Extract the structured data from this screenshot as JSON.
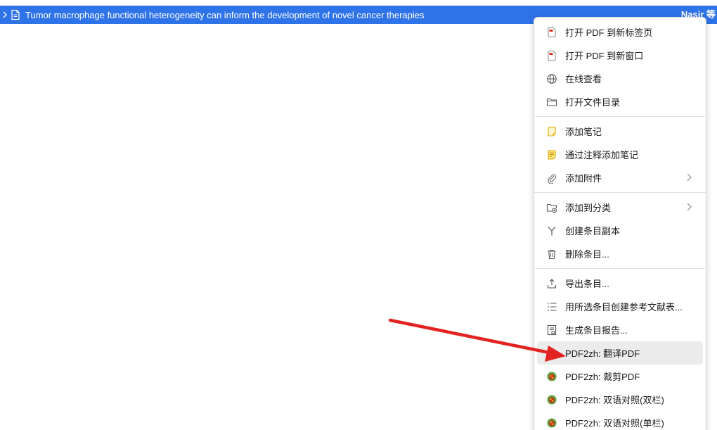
{
  "row": {
    "title": "Tumor macrophage functional heterogeneity can inform the development of novel cancer therapies",
    "creator": "Nasir 等"
  },
  "menu": {
    "groups": [
      [
        {
          "label": "打开 PDF 到新标签页",
          "icon": "pdf-icon"
        },
        {
          "label": "打开 PDF 到新窗口",
          "icon": "pdf-icon"
        },
        {
          "label": "在线查看",
          "icon": "globe-icon"
        },
        {
          "label": "打开文件目录",
          "icon": "folder-icon"
        }
      ],
      [
        {
          "label": "添加笔记",
          "icon": "note-icon"
        },
        {
          "label": "通过注释添加笔记",
          "icon": "annotation-note-icon"
        },
        {
          "label": "添加附件",
          "icon": "paperclip-icon",
          "submenu": true
        }
      ],
      [
        {
          "label": "添加到分类",
          "icon": "add-folder-icon",
          "submenu": true
        },
        {
          "label": "创建条目副本",
          "icon": "duplicate-icon"
        },
        {
          "label": "删除条目...",
          "icon": "trash-icon"
        }
      ],
      [
        {
          "label": "导出条目...",
          "icon": "export-icon"
        },
        {
          "label": "用所选条目创建参考文献表...",
          "icon": "bibliography-icon"
        },
        {
          "label": "生成条目报告...",
          "icon": "report-icon"
        },
        {
          "label": "PDF2zh: 翻译PDF",
          "icon": "pdf2zh-icon",
          "hover": true
        },
        {
          "label": "PDF2zh: 裁剪PDF",
          "icon": "pdf2zh-icon"
        },
        {
          "label": "PDF2zh: 双语对照(双栏)",
          "icon": "pdf2zh-icon"
        },
        {
          "label": "PDF2zh: 双语对照(单栏)",
          "icon": "pdf2zh-icon"
        }
      ]
    ]
  },
  "colors": {
    "selection": "#2f73e8",
    "arrow": "#e32222"
  }
}
